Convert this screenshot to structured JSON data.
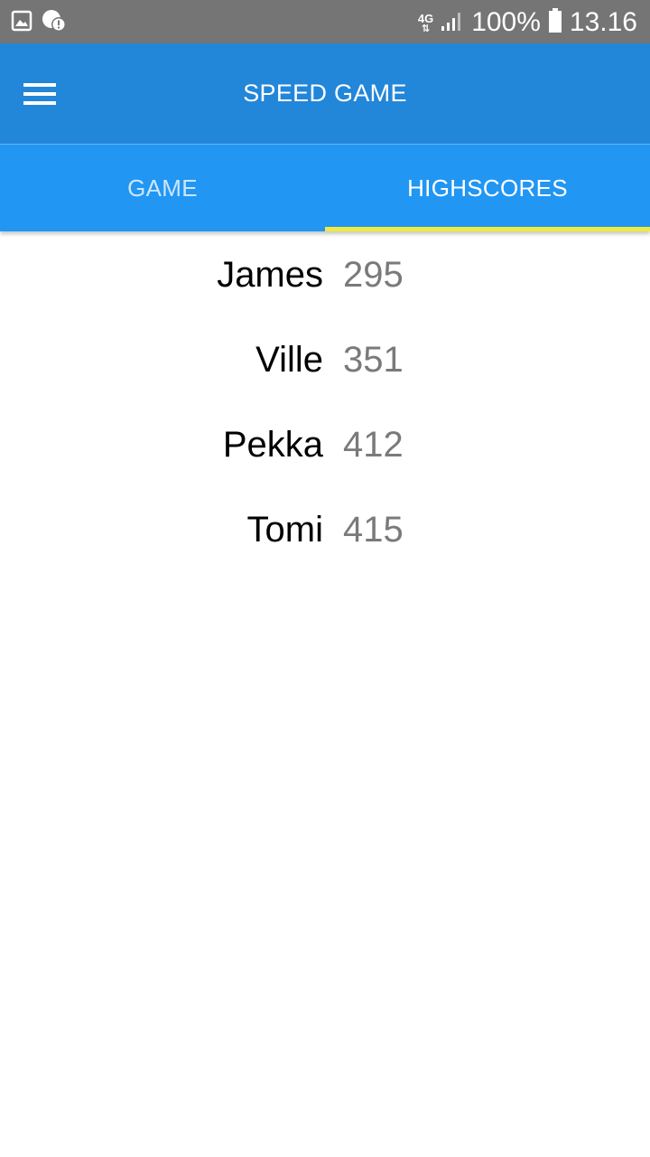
{
  "status_bar": {
    "network": "4G",
    "battery": "100%",
    "time": "13.16",
    "icons": [
      "image-icon",
      "alert-icon",
      "signal-icon",
      "battery-icon"
    ]
  },
  "app_bar": {
    "title": "SPEED GAME",
    "menu_icon": "hamburger-menu-icon"
  },
  "tabs": [
    {
      "label": "GAME",
      "selected": false
    },
    {
      "label": "HIGHSCORES",
      "selected": true
    }
  ],
  "highscores": [
    {
      "name": "James",
      "score": "295"
    },
    {
      "name": "Ville",
      "score": "351"
    },
    {
      "name": "Pekka",
      "score": "412"
    },
    {
      "name": "Tomi",
      "score": "415"
    }
  ],
  "colors": {
    "app_bar": "#2286d9",
    "tab_bar": "#2196f3",
    "tab_indicator": "#f2ea3c",
    "status_bar": "#757575",
    "score_value": "#7a7a7a"
  }
}
